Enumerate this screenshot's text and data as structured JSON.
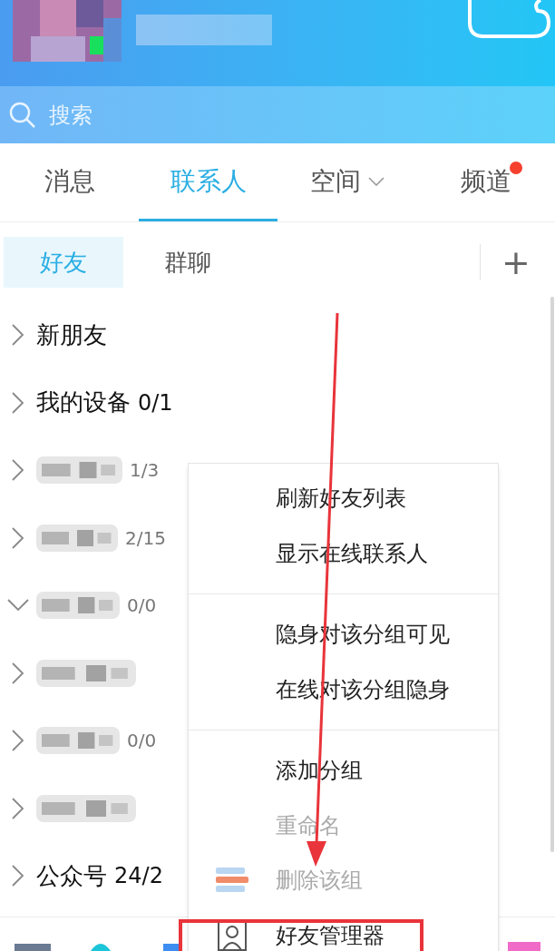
{
  "search": {
    "placeholder": "搜索"
  },
  "tabs": [
    {
      "label": "消息",
      "selected": false
    },
    {
      "label": "联系人",
      "selected": true
    },
    {
      "label": "空间",
      "selected": false,
      "dropdown": true
    },
    {
      "label": "频道",
      "selected": false,
      "badge": true
    }
  ],
  "subtabs": [
    {
      "label": "好友",
      "selected": true
    },
    {
      "label": "群聊",
      "selected": false
    }
  ],
  "add_button": {
    "label": "+"
  },
  "groups": [
    {
      "kind": "named",
      "name": "新朋友",
      "expanded": false
    },
    {
      "kind": "named",
      "name": "我的设备",
      "count": "0/1",
      "expanded": false
    },
    {
      "kind": "redacted",
      "count": "1/3",
      "expanded": false
    },
    {
      "kind": "redacted",
      "count": "2/15",
      "expanded": false
    },
    {
      "kind": "redacted",
      "count": "0/0",
      "expanded": true
    },
    {
      "kind": "redacted",
      "expanded": false
    },
    {
      "kind": "redacted",
      "count": "0/0",
      "expanded": false
    },
    {
      "kind": "redacted",
      "expanded": false
    },
    {
      "kind": "named",
      "name": "公众号",
      "count": "24/2",
      "expanded": false
    }
  ],
  "context_menu": {
    "sections": [
      [
        {
          "kind": "plain",
          "label": "刷新好友列表",
          "disabled": false
        },
        {
          "kind": "plain",
          "label": "显示在线联系人",
          "disabled": false
        }
      ],
      [
        {
          "kind": "plain",
          "label": "隐身对该分组可见",
          "disabled": false
        },
        {
          "kind": "plain",
          "label": "在线对该分组隐身",
          "disabled": false
        }
      ],
      [
        {
          "kind": "plain",
          "label": "添加分组",
          "disabled": false
        },
        {
          "kind": "plain",
          "label": "重命名",
          "disabled": true
        },
        {
          "kind": "stack",
          "label": "删除该组",
          "disabled": true
        },
        {
          "kind": "person",
          "label": "好友管理器",
          "disabled": false
        }
      ]
    ]
  }
}
